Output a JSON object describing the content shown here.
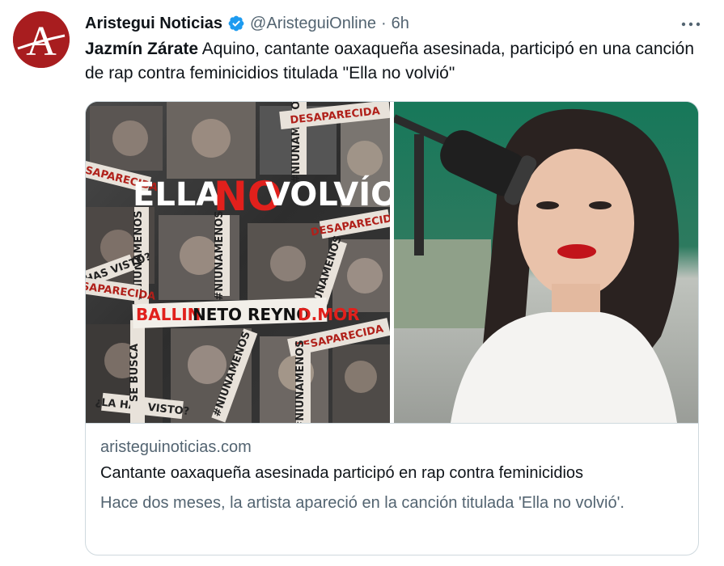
{
  "account": {
    "display_name": "Aristegui Noticias",
    "handle": "@AristeguiOnline",
    "separator": "·",
    "time": "6h",
    "avatar_letter": "A",
    "verified": true
  },
  "tweet": {
    "text_bold": "Jazmín Zárate",
    "text_rest": " Aquino, cantante oaxaqueña asesinada, participó en  una canción de rap contra feminicidios titulada \"Ella no volvió\""
  },
  "card": {
    "domain": "aristeguinoticias.com",
    "title": "Cantante oaxaqueña asesinada participó en rap contra feminicidios",
    "description": "Hace dos meses, la artista apareció en la canción titulada 'Ella no volvió'."
  },
  "poster": {
    "title_left": "ELLA",
    "title_mid": "NO",
    "title_right": "VOLVÍO",
    "artists": [
      "BALLIN",
      "NETO REYNO",
      "D.MOR"
    ],
    "strip_texts": [
      "#NIUNAMENOS",
      "DESAPARECIDA",
      "SE BUSCA",
      "¿LA HAS VISTO?"
    ]
  },
  "colors": {
    "accent_blue": "#1d9bf0",
    "brand_red": "#a81d1f",
    "text_primary": "#0f1419",
    "text_secondary": "#536471"
  },
  "icons": {
    "verified": "verified-badge-icon",
    "more": "more-options-icon"
  }
}
